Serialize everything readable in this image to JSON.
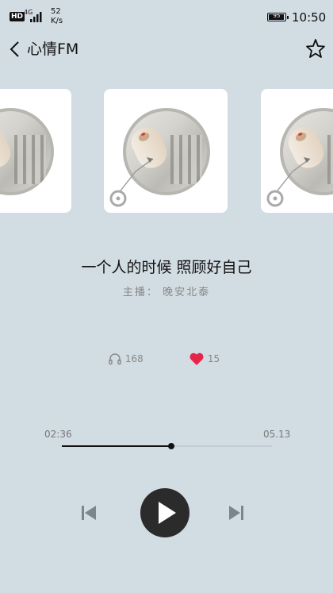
{
  "status_bar": {
    "hd": "HD",
    "network": "4G",
    "speed_value": "52",
    "speed_unit": "K/s",
    "battery": "95",
    "time": "10:50"
  },
  "header": {
    "title": "心情FM",
    "back_icon": "chevron-left-icon",
    "favorite_icon": "star-outline-icon"
  },
  "track": {
    "title": "一个人的时候 照顾好自己",
    "host_label": "主播：",
    "host_name": "晚安北泰"
  },
  "stats": {
    "listen_count": "168",
    "like_count": "15",
    "like_color": "#e8234a"
  },
  "progress": {
    "current": "02:36",
    "total": "05.13",
    "fraction": 0.52
  },
  "controls": {
    "prev_icon": "skip-previous-icon",
    "play_icon": "play-icon",
    "next_icon": "skip-next-icon"
  },
  "colors": {
    "background": "#d2dce3",
    "accent": "#2b2b2b"
  }
}
